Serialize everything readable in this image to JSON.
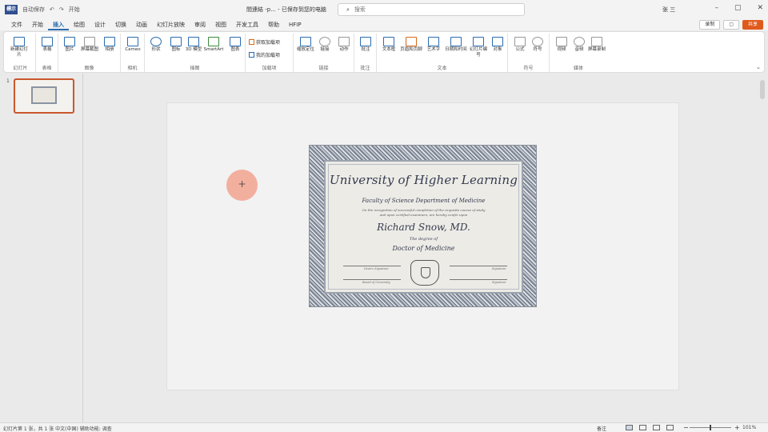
{
  "titlebar": {
    "logo_text": "標示",
    "filename": "間連結 -p... - 已保存到您的电脑",
    "search_placeholder": "搜索",
    "user": "张 三",
    "qa_items": [
      "自动保存",
      "↶",
      "↷",
      "开始"
    ]
  },
  "menu": {
    "tabs": [
      "文件",
      "开始",
      "插入",
      "绘图",
      "设计",
      "切换",
      "动画",
      "幻灯片放映",
      "审阅",
      "视图",
      "开发工具",
      "帮助",
      "HFIP"
    ],
    "active_index": 2,
    "record_btn": "录制",
    "present_btn": "▢",
    "share_btn": "共享"
  },
  "ribbon": {
    "groups": [
      {
        "label": "幻灯片",
        "buttons": [
          "新建幻灯片"
        ]
      },
      {
        "label": "表格",
        "buttons": [
          "表格"
        ]
      },
      {
        "label": "图像",
        "buttons": [
          "图片",
          "屏幕截图",
          "相册"
        ]
      },
      {
        "label": "相机",
        "buttons": [
          "Cameo"
        ]
      },
      {
        "label": "插图",
        "buttons": [
          "形状",
          "图标",
          "3D 模型",
          "SmartArt",
          "图表"
        ]
      },
      {
        "label": "加载项",
        "buttons": [
          "获取加载项",
          "我的加载项"
        ]
      },
      {
        "label": "链接",
        "buttons": [
          "缩放定位",
          "链接",
          "动作"
        ]
      },
      {
        "label": "批注",
        "buttons": [
          "批注"
        ]
      },
      {
        "label": "文本",
        "buttons": [
          "文本框",
          "页眉和页脚",
          "艺术字",
          "日期和时间",
          "幻灯片编号",
          "对象"
        ]
      },
      {
        "label": "符号",
        "buttons": [
          "公式",
          "符号"
        ]
      },
      {
        "label": "媒体",
        "buttons": [
          "视频",
          "音频",
          "屏幕录制"
        ]
      }
    ]
  },
  "thumbs": {
    "number": "1"
  },
  "certificate": {
    "title": "University of Higher Learning",
    "faculty": "Faculty of Science Department of Medicine",
    "line1": "On the recognition of successful completion of the requisite course of study",
    "line2": "and upon certified examiners, are hereby confer upon",
    "name": "Richard Snow, MD.",
    "degree_intro": "The degree of",
    "degree": "Doctor of Medicine",
    "sig_left_top": "Dean's Signature",
    "sig_left_bottom": "Board of University",
    "sig_right_top": "Signature",
    "sig_right_bottom": "Signature"
  },
  "status": {
    "left": "幻灯片第 1 张，共 1 张   中文(中国)   辅助功能: 调查",
    "notes": "备注",
    "zoom": "101%"
  },
  "colors": {
    "accent": "#2b6cb0",
    "share": "#e05a1c",
    "selection": "#c9572b"
  }
}
